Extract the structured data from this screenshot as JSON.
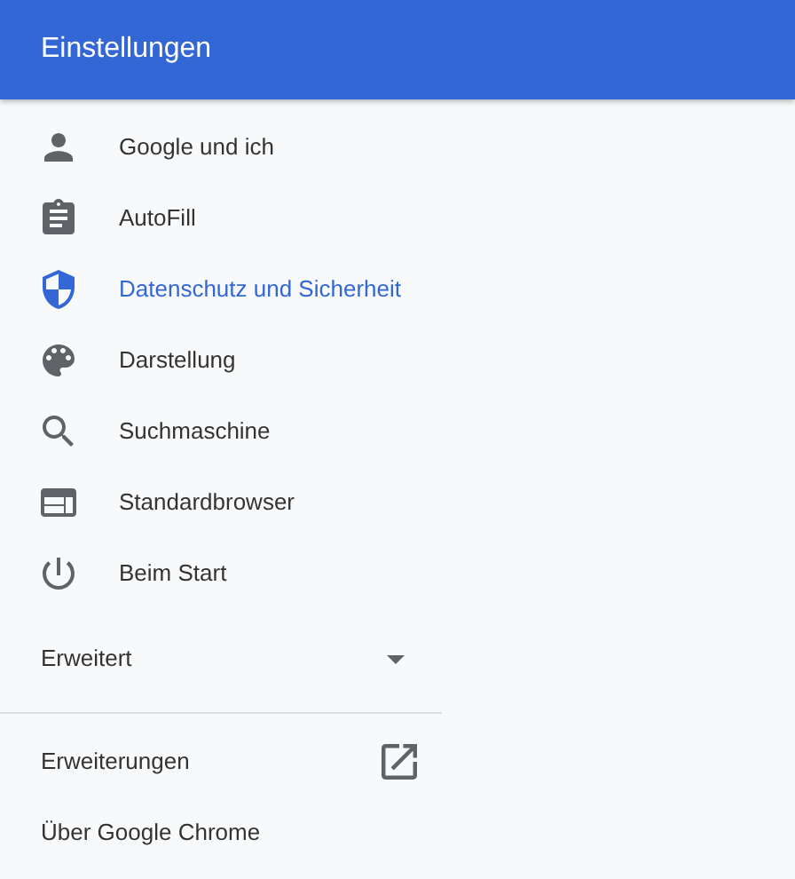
{
  "header": {
    "title": "Einstellungen"
  },
  "nav_items": [
    {
      "label": "Google und ich",
      "selected": false
    },
    {
      "label": "AutoFill",
      "selected": false
    },
    {
      "label": "Datenschutz und Sicherheit",
      "selected": true
    },
    {
      "label": "Darstellung",
      "selected": false
    },
    {
      "label": "Suchmaschine",
      "selected": false
    },
    {
      "label": "Standardbrowser",
      "selected": false
    },
    {
      "label": "Beim Start",
      "selected": false
    }
  ],
  "advanced": {
    "label": "Erweitert",
    "expanded": false
  },
  "footer_links": [
    {
      "label": "Erweiterungen",
      "external": true
    },
    {
      "label": "Über Google Chrome",
      "external": false
    }
  ]
}
